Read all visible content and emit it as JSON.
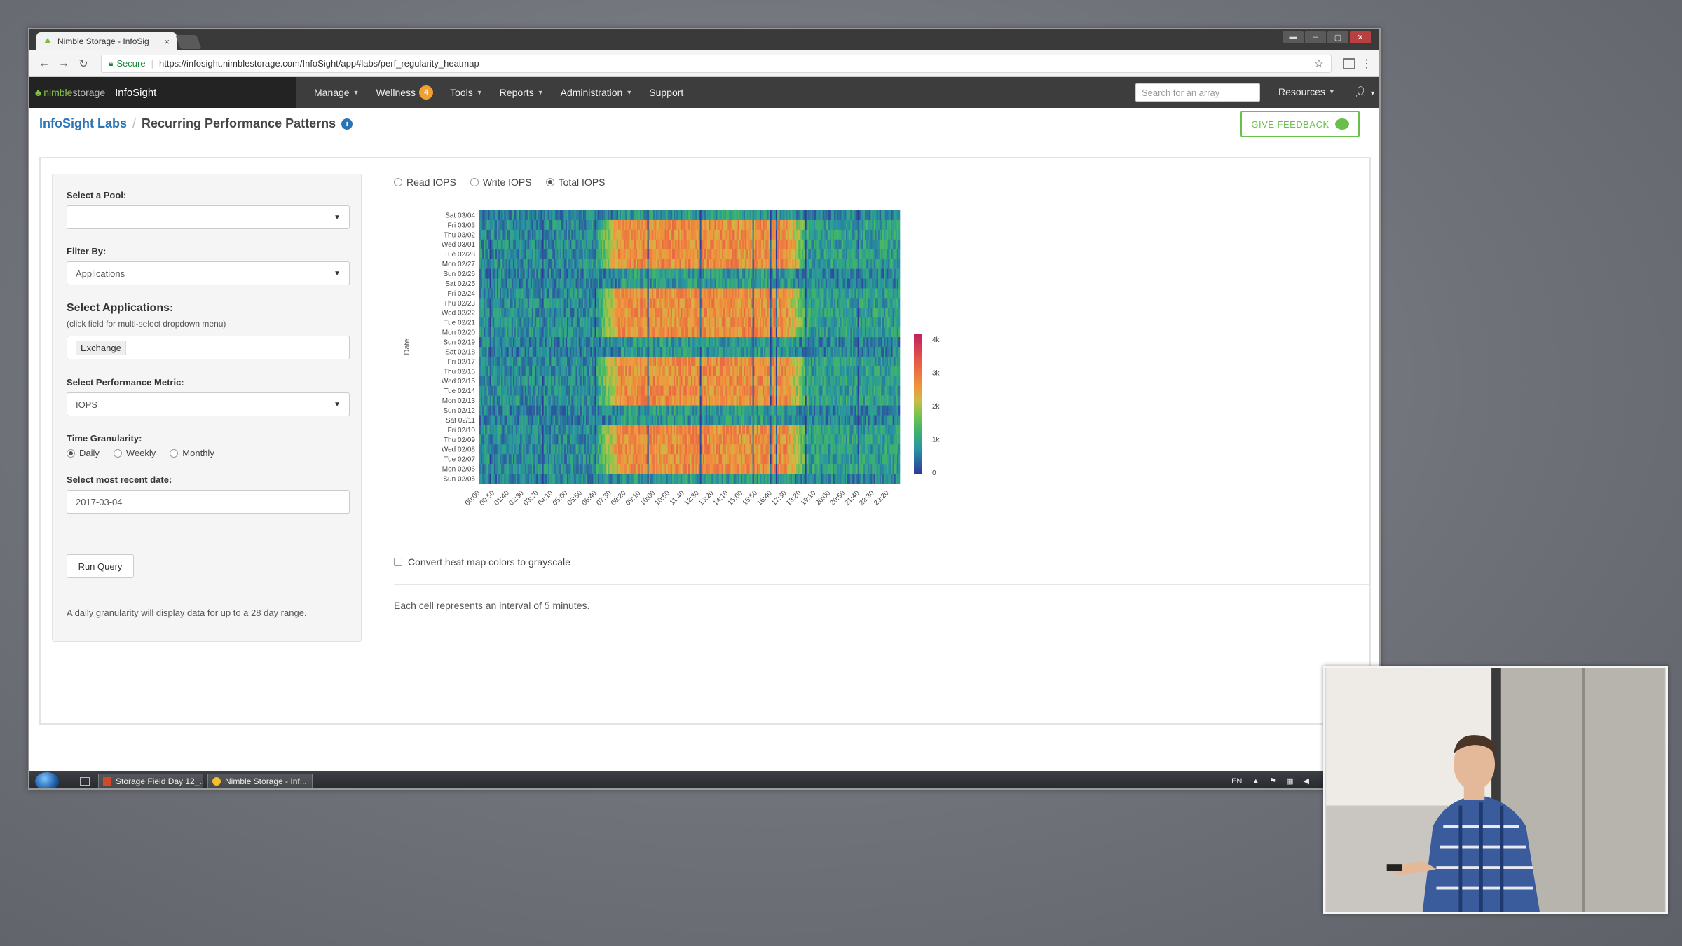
{
  "browser": {
    "tab_title": "Nimble Storage - InfoSig",
    "tab_close": "×",
    "secure_label": "Secure",
    "url": "https://infosight.nimblestorage.com/InfoSight/app#labs/perf_regularity_heatmap"
  },
  "nav": {
    "brand_nimble": "nimble",
    "brand_storage": "storage",
    "brand_infosight": "InfoSight",
    "items": [
      "Manage",
      "Wellness",
      "Tools",
      "Reports",
      "Administration",
      "Support"
    ],
    "wellness_count": "4",
    "search_placeholder": "Search for an array",
    "resources_label": "Resources"
  },
  "breadcrumb": {
    "root": "InfoSight Labs",
    "separator": "/",
    "current": "Recurring Performance Patterns",
    "info_glyph": "i"
  },
  "feedback_label": "GIVE FEEDBACK",
  "form": {
    "pool_label": "Select a Pool:",
    "pool_value": "",
    "filter_label": "Filter By:",
    "filter_value": "Applications",
    "apps_label": "Select Applications:",
    "apps_hint": "(click field for multi-select dropdown menu)",
    "apps_token": "Exchange",
    "metric_label": "Select Performance Metric:",
    "metric_value": "IOPS",
    "granularity_label": "Time Granularity:",
    "granularity_options": [
      "Daily",
      "Weekly",
      "Monthly"
    ],
    "granularity_selected": "Daily",
    "date_label": "Select most recent date:",
    "date_value": "2017-03-04",
    "run_label": "Run Query",
    "note": "A daily granularity will display data for up to a 28 day range."
  },
  "metric_options": [
    "Read IOPS",
    "Write IOPS",
    "Total IOPS"
  ],
  "metric_selected": "Total IOPS",
  "grayscale_label": "Convert heat map colors to grayscale",
  "cell_note": "Each cell represents an interval of 5 minutes.",
  "chart_data": {
    "type": "heatmap",
    "title": "",
    "xlabel": "",
    "ylabel": "Date",
    "y_categories": [
      "Sat 03/04",
      "Fri 03/03",
      "Thu 03/02",
      "Wed 03/01",
      "Tue 02/28",
      "Mon 02/27",
      "Sun 02/26",
      "Sat 02/25",
      "Fri 02/24",
      "Thu 02/23",
      "Wed 02/22",
      "Tue 02/21",
      "Mon 02/20",
      "Sun 02/19",
      "Sat 02/18",
      "Fri 02/17",
      "Thu 02/16",
      "Wed 02/15",
      "Tue 02/14",
      "Mon 02/13",
      "Sun 02/12",
      "Sat 02/11",
      "Fri 02/10",
      "Thu 02/09",
      "Wed 02/08",
      "Tue 02/07",
      "Mon 02/06",
      "Sun 02/05"
    ],
    "x_tick_labels": [
      "00:00",
      "00:50",
      "01:40",
      "02:30",
      "03:20",
      "04:10",
      "05:00",
      "05:50",
      "06:40",
      "07:30",
      "08:20",
      "09:10",
      "10:00",
      "10:50",
      "11:40",
      "12:30",
      "13:20",
      "14:10",
      "15:00",
      "15:50",
      "16:40",
      "17:30",
      "18:20",
      "19:10",
      "20:00",
      "20:50",
      "21:40",
      "22:30",
      "23:20"
    ],
    "x_interval_minutes": 5,
    "row_types": [
      "weekend",
      "weekday",
      "weekday",
      "weekday",
      "weekday",
      "weekday",
      "weekend",
      "weekend",
      "weekday",
      "weekday",
      "weekday",
      "weekday",
      "weekday",
      "weekend",
      "weekend",
      "weekday",
      "weekday",
      "weekday",
      "weekday",
      "weekday",
      "weekend",
      "weekend",
      "weekday",
      "weekday",
      "weekday",
      "weekday",
      "weekday",
      "weekend"
    ],
    "approx_levels_iops": {
      "night": 700,
      "weekday_business_hours": 2600,
      "weekend": 600
    },
    "colorbar": {
      "ticks": [
        "0",
        "1k",
        "2k",
        "3k",
        "4k"
      ],
      "min": 0,
      "max": 4000
    },
    "colors": {
      "low": "#2d3a9a",
      "mid_low": "#2bb08a",
      "mid": "#6ec25a",
      "mid_high": "#f0a040",
      "high": "#e05050",
      "max": "#c02060"
    }
  }
}
